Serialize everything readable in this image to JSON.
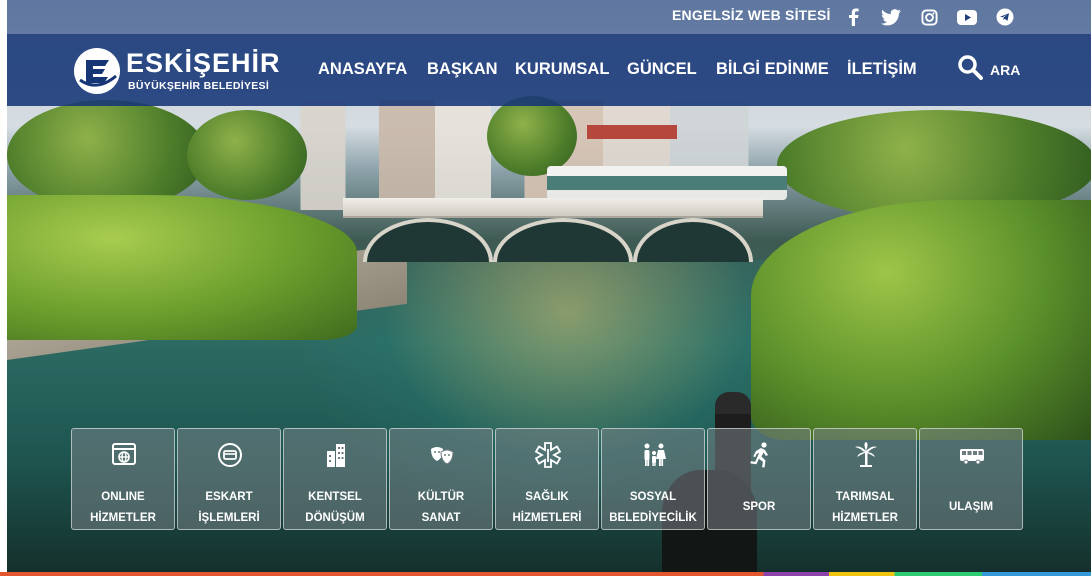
{
  "topbar": {
    "accessibility_link": "ENGELSİZ WEB SİTESİ",
    "social_icons": [
      "facebook-icon",
      "twitter-icon",
      "instagram-icon",
      "youtube-icon",
      "telegram-icon"
    ]
  },
  "brand": {
    "title": "ESKİŞEHİR",
    "subtitle": "BÜYÜKŞEHİR BELEDİYESİ"
  },
  "nav": {
    "items": [
      "ANASAYFA",
      "BAŞKAN",
      "KURUMSAL",
      "GÜNCEL",
      "BİLGİ EDİNME",
      "İLETİŞİM"
    ],
    "search_label": "ARA"
  },
  "services": [
    {
      "line1": "ONLINE",
      "line2": "HİZMETLER",
      "icon": "globe-window-icon"
    },
    {
      "line1": "ESKART",
      "line2": "İŞLEMLERİ",
      "icon": "card-hand-icon"
    },
    {
      "line1": "KENTSEL",
      "line2": "DÖNÜŞÜM",
      "icon": "buildings-icon"
    },
    {
      "line1": "KÜLTÜR",
      "line2": "SANAT",
      "icon": "theater-masks-icon"
    },
    {
      "line1": "SAĞLIK",
      "line2": "HİZMETLERİ",
      "icon": "medical-star-icon"
    },
    {
      "line1": "SOSYAL",
      "line2": "BELEDİYECİLİK",
      "icon": "family-icon"
    },
    {
      "line1": "SPOR",
      "line2": "",
      "icon": "runner-icon"
    },
    {
      "line1": "TARIMSAL",
      "line2": "HİZMETLER",
      "icon": "palm-tree-icon"
    },
    {
      "line1": "ULAŞIM",
      "line2": "",
      "icon": "bus-icon"
    }
  ],
  "colors": {
    "nav_bg": "#163676",
    "text": "#ffffff"
  }
}
